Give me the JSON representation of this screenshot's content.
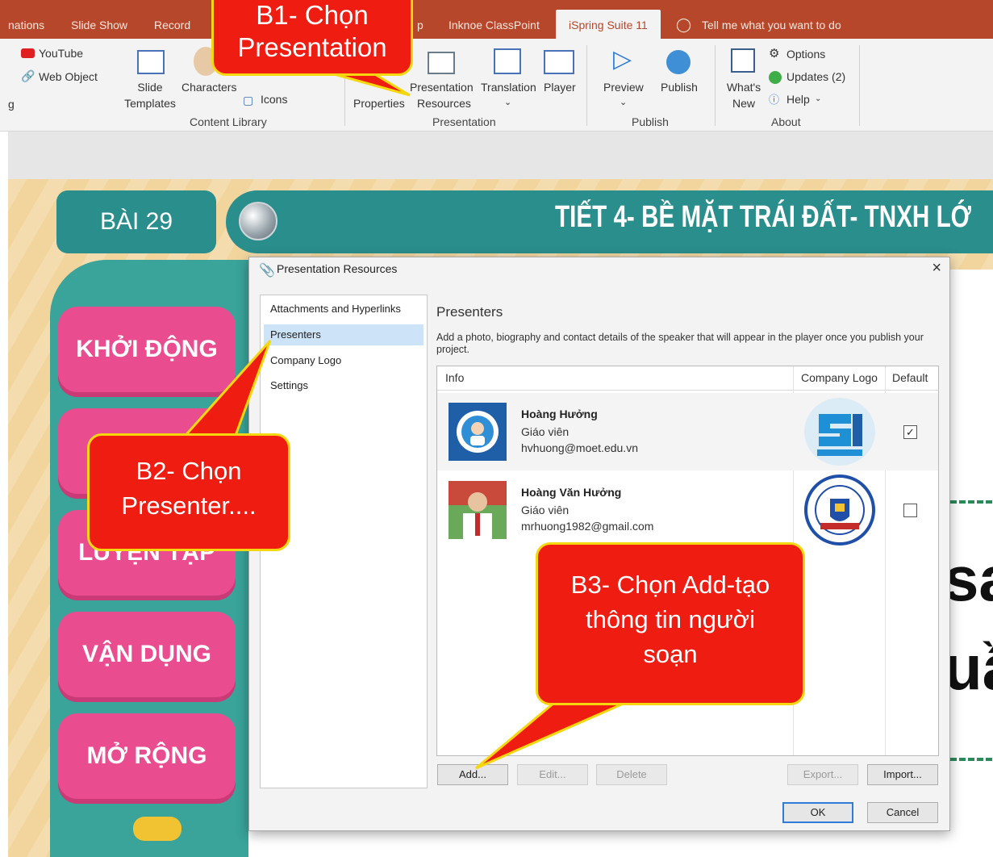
{
  "ribbon": {
    "tabs": [
      "nations",
      "Slide Show",
      "Record",
      "p",
      "Inknoe ClassPoint",
      "iSpring Suite 11"
    ],
    "tell_me": "Tell me what you want to do",
    "youtube": "YouTube",
    "web_object": "Web Object",
    "cut_letter": "g",
    "slide_templates": [
      "Slide",
      "Templates"
    ],
    "characters": "Characters",
    "icons": "Icons",
    "properties": "Properties",
    "presentation_resources": [
      "Presentation",
      "Resources"
    ],
    "translation": "Translation",
    "player": "Player",
    "preview": "Preview",
    "publish": "Publish",
    "whats_new": [
      "What's",
      "New"
    ],
    "options": "Options",
    "updates": "Updates (2)",
    "help": "Help",
    "groups": [
      "Content Library",
      "Presentation",
      "Publish",
      "About"
    ]
  },
  "slide": {
    "lesson": "BÀI 29",
    "title": "TIẾT 4- BỀ MẶT TRÁI ĐẤT- TNXH LỚ",
    "menu": [
      "KHỞI ĐỘNG",
      "LUYỆN TẬP",
      "VẬN DỤNG",
      "MỞ RỘNG"
    ],
    "big_text": [
      "sa",
      "uầ"
    ]
  },
  "dialog": {
    "title": "Presentation Resources",
    "nav": [
      "Attachments and Hyperlinks",
      "Presenters",
      "Company Logo",
      "Settings"
    ],
    "heading": "Presenters",
    "description": "Add a photo, biography and contact details of the speaker that will appear in the player once you publish your project.",
    "columns": [
      "Info",
      "Company Logo",
      "Default"
    ],
    "presenters": [
      {
        "name": "Hoàng Hưởng",
        "role": "Giáo viên",
        "email": "hvhuong@moet.edu.vn",
        "default": true
      },
      {
        "name": "Hoàng Văn Hưởng",
        "role": "Giáo viên",
        "email": "mrhuong1982@gmail.com",
        "default": false
      }
    ],
    "buttons": {
      "add": "Add...",
      "edit": "Edit...",
      "delete": "Delete",
      "export": "Export...",
      "import": "Import...",
      "ok": "OK",
      "cancel": "Cancel"
    }
  },
  "callouts": {
    "b1": [
      "B1- Chọn",
      "Presentation"
    ],
    "b2": [
      "B2- Chọn",
      "Presenter...."
    ],
    "b3": [
      "B3- Chọn Add-tạo",
      "thông tin người",
      "soạn"
    ]
  },
  "colors": {
    "ribbon": "#b7472a",
    "callout": "#ef1c12",
    "callout_border": "#f4d70f",
    "teal": "#2a8e8c",
    "pink": "#e94d8f"
  }
}
